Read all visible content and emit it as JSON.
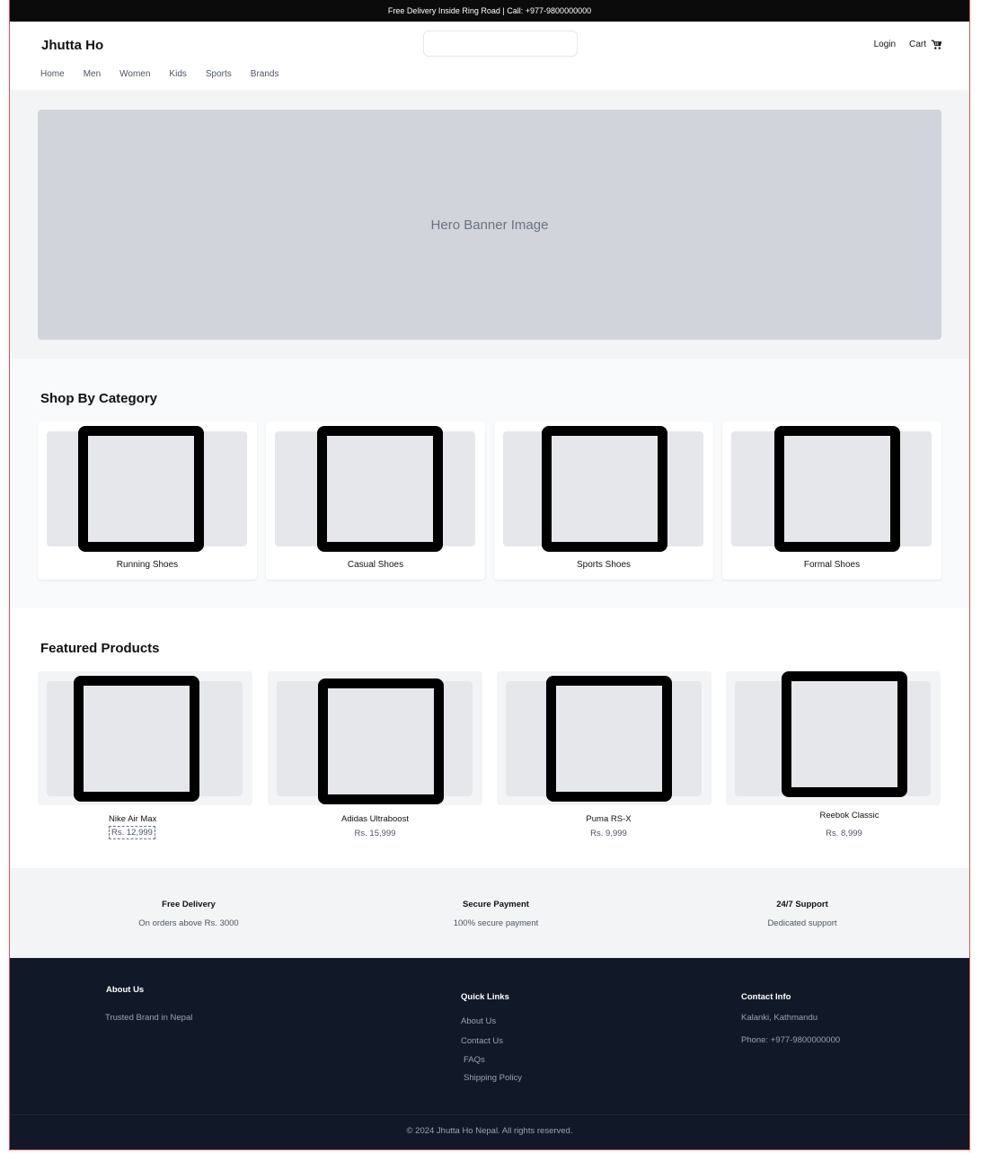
{
  "topbar": {
    "text": "Free Delivery Inside Ring Road | Call: +977-9800000000"
  },
  "header": {
    "logo": "Jhutta Ho",
    "search_placeholder": "",
    "login": "Login",
    "cart": "Cart",
    "cart_icon": "cart-icon",
    "nav": [
      "Home",
      "Men",
      "Women",
      "Kids",
      "Sports",
      "Brands"
    ]
  },
  "hero": {
    "text": "Hero Banner Image"
  },
  "categories": {
    "title": "Shop By Category",
    "items": [
      "Running Shoes",
      "Casual Shoes",
      "Sports Shoes",
      "Formal Shoes"
    ]
  },
  "featured": {
    "title": "Featured Products",
    "items": [
      {
        "name": "Nike Air Max",
        "price": "Rs. 12,999"
      },
      {
        "name": "Adidas Ultraboost",
        "price": "Rs. 15,999"
      },
      {
        "name": "Puma RS-X",
        "price": "Rs. 9,999"
      },
      {
        "name": "Reebok Classic",
        "price": "Rs. 8,999"
      }
    ]
  },
  "features": [
    {
      "title": "Free Delivery",
      "desc": "On orders above Rs. 3000"
    },
    {
      "title": "Secure Payment",
      "desc": "100% secure payment"
    },
    {
      "title": "24/7 Support",
      "desc": "Dedicated support"
    }
  ],
  "footer": {
    "about_title": "About Us",
    "about_text": "Trusted Brand in Nepal",
    "links_title": "Quick Links",
    "links": [
      "About Us",
      "Contact Us",
      "FAQs",
      "Shipping Policy"
    ],
    "contact_title": "Contact Info",
    "contact": [
      "Kalanki, Kathmandu",
      "Phone: +977-9800000000"
    ],
    "copyright": "© 2024 Jhutta Ho Nepal. All rights reserved."
  },
  "colors": {
    "dark": "#111827",
    "topbar": "#0b0b0b",
    "hero": "#d1d5db",
    "accent_border": "#e05252"
  }
}
